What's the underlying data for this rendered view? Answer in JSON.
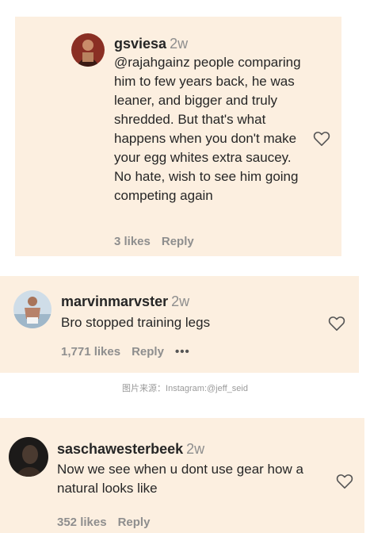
{
  "comments": [
    {
      "username": "gsviesa",
      "time": "2w",
      "mention": "@rajahgainz",
      "text": " people comparing him to few years back, he was leaner, and bigger and truly shredded. But that's what happens when you don't make your egg whites extra saucey. No hate, wish to see him going competing again",
      "likes": "3 likes",
      "reply": "Reply"
    },
    {
      "username": "marvinmarvster",
      "time": "2w",
      "text": "Bro stopped training legs",
      "likes": "1,771 likes",
      "reply": "Reply",
      "more": "•••"
    },
    {
      "username": "saschawesterbeek",
      "time": "2w",
      "text": "Now we see when u dont use gear how a natural looks like",
      "likes": "352 likes",
      "reply": "Reply"
    }
  ],
  "caption": "图片来源：Instagram:@jeff_seid",
  "icons": {
    "like": "heart-outline-icon",
    "more": "more-horizontal-icon"
  },
  "colors": {
    "card_background": "#fcefe0",
    "text": "#262626",
    "muted": "#8e8e8e"
  }
}
